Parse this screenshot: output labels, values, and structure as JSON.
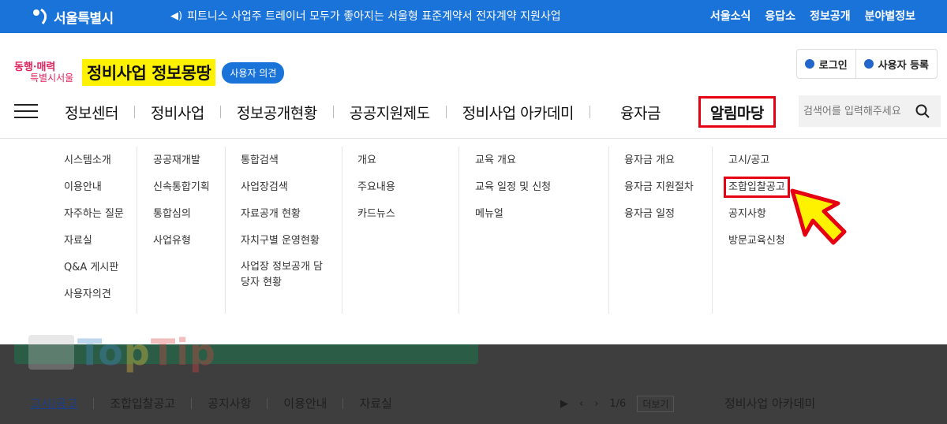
{
  "topbar": {
    "logo_text": "서울특별시",
    "notice": "피트니스 사업주 트레이너 모두가 좋아지는 서울형 표준계약서 전자계약 지원사업",
    "utils": [
      "서울소식",
      "응답소",
      "정보공개",
      "분야별정보"
    ]
  },
  "brand": {
    "slogan_line1": "동행·매력",
    "slogan_line2": "특별시서울",
    "title": "정비사업 정보몽땅",
    "pill": "사용자 의견"
  },
  "auth": {
    "login": "로그인",
    "register": "사용자 등록"
  },
  "nav": {
    "items": [
      "정보센터",
      "정비사업",
      "정보공개현황",
      "공공지원제도",
      "정비사업 아카데미",
      "융자금",
      "알림마당"
    ]
  },
  "search": {
    "placeholder": "검색어를 입력해주세요"
  },
  "menu": {
    "col1": [
      "시스템소개",
      "이용안내",
      "자주하는 질문",
      "자료실",
      "Q&A 게시판",
      "사용자의견"
    ],
    "col2": [
      "공공재개발",
      "신속통합기획",
      "통합심의",
      "사업유형"
    ],
    "col3": [
      "통합검색",
      "사업장검색",
      "자료공개 현황",
      "자치구별 운영현황",
      "사업장 정보공개 담당자 현황"
    ],
    "col4": [
      "개요",
      "주요내용",
      "카드뉴스"
    ],
    "col5": [
      "교육 개요",
      "교육 일정 및 신청",
      "메뉴얼"
    ],
    "col6": [
      "융자금 개요",
      "융자금 지원절차",
      "융자금 일정"
    ],
    "col7": [
      "고시/공고",
      "조합입찰공고",
      "공지사항",
      "방문교육신청"
    ]
  },
  "watermark": {
    "part1": "To",
    "part2": "p",
    "part3": "Tip"
  },
  "bottom": {
    "tabs": [
      "고시/공고",
      "조합입찰공고",
      "공지사항",
      "이용안내",
      "자료실"
    ],
    "page": "1/6",
    "more": "더보기",
    "academy": "정비사업 아카데미"
  },
  "colors": {
    "brand_blue": "#1a73d9",
    "highlight_red": "#e50012",
    "yellow": "#fff200"
  }
}
